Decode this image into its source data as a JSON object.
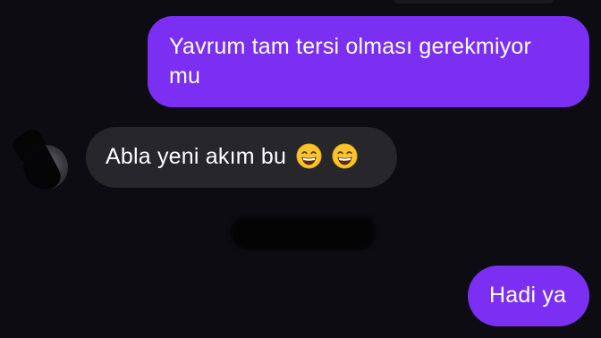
{
  "conversation": {
    "messages": [
      {
        "sender": "me",
        "text": "Yavrum tam tersi olması gerekmiyor mu"
      },
      {
        "sender": "other",
        "text": "Abla yeni akım bu",
        "emoji": [
          "grinning-face-with-smiling-eyes",
          "grinning-face-with-smiling-eyes"
        ]
      },
      {
        "sender": "me",
        "text": "Hadi ya"
      }
    ]
  },
  "colors": {
    "background": "#0c0c12",
    "outgoing_bubble": "#7b2ff2",
    "incoming_bubble": "#26262b",
    "text": "#ffffff"
  }
}
